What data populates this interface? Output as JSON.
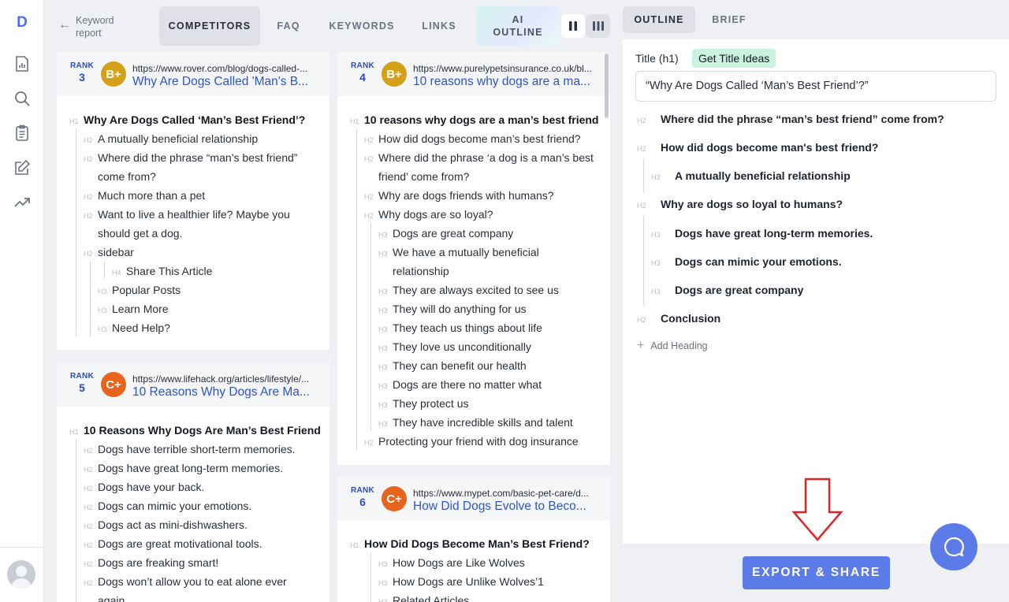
{
  "nav": {
    "logo": "D",
    "icons": [
      "chart-icon",
      "search-icon",
      "clipboard-icon",
      "edit-icon",
      "trending-icon"
    ]
  },
  "topbar": {
    "back_label": "Keyword report",
    "tabs": [
      {
        "label": "COMPETITORS",
        "active": true
      },
      {
        "label": "FAQ",
        "active": false
      },
      {
        "label": "KEYWORDS",
        "active": false
      },
      {
        "label": "LINKS",
        "active": false
      }
    ],
    "ai_tab": {
      "line1": "AI",
      "line2": "OUTLINE"
    }
  },
  "competitors": [
    {
      "rank_label": "RANK",
      "rank": "3",
      "grade": "B+",
      "url": "https://www.rover.com/blog/dogs-called-...",
      "title": "Why Are Dogs Called 'Man's B...",
      "headings": [
        {
          "tag": "H1",
          "text": "Why Are Dogs Called ‘Man’s Best Friend’?"
        },
        {
          "tag": "H2",
          "text": "A mutually beneficial relationship"
        },
        {
          "tag": "H2",
          "text": "Where did the phrase “man’s best friend”"
        },
        {
          "tag": "",
          "text": "come from?"
        },
        {
          "tag": "H2",
          "text": "Much more than a pet"
        },
        {
          "tag": "H2",
          "text": "Want to live a healthier life? Maybe you"
        },
        {
          "tag": "",
          "text": "should get a dog."
        },
        {
          "tag": "H2",
          "text": "sidebar"
        },
        {
          "tag": "H4",
          "text": "Share This Article"
        },
        {
          "tag": "H3",
          "text": "Popular Posts"
        },
        {
          "tag": "H3",
          "text": "Learn More"
        },
        {
          "tag": "H3",
          "text": "Need Help?"
        }
      ]
    },
    {
      "rank_label": "RANK",
      "rank": "5",
      "grade": "C+",
      "url": "https://www.lifehack.org/articles/lifestyle/...",
      "title": "10 Reasons Why Dogs Are Ma...",
      "headings": [
        {
          "tag": "H1",
          "text": "10 Reasons Why Dogs Are Man’s Best Friend"
        },
        {
          "tag": "H2",
          "text": "Dogs have terrible short-term memories."
        },
        {
          "tag": "H2",
          "text": "Dogs have great long-term memories."
        },
        {
          "tag": "H2",
          "text": "Dogs have your back."
        },
        {
          "tag": "H2",
          "text": "Dogs can mimic your emotions."
        },
        {
          "tag": "H2",
          "text": "Dogs act as mini-dishwashers."
        },
        {
          "tag": "H2",
          "text": "Dogs are great motivational tools."
        },
        {
          "tag": "H2",
          "text": "Dogs are freaking smart!"
        },
        {
          "tag": "H2",
          "text": "Dogs won’t allow you to eat alone ever"
        },
        {
          "tag": "",
          "text": "again"
        }
      ]
    },
    {
      "rank_label": "RANK",
      "rank": "4",
      "grade": "B+",
      "url": "https://www.purelypetsinsurance.co.uk/bl...",
      "title": "10 reasons why dogs are a ma...",
      "headings": [
        {
          "tag": "H1",
          "text": "10 reasons why dogs are a man’s best friend"
        },
        {
          "tag": "H2",
          "text": "How did dogs become man’s best friend?"
        },
        {
          "tag": "H2",
          "text": "Where did the phrase ‘a dog is a man’s best"
        },
        {
          "tag": "",
          "text": "friend’ come from?"
        },
        {
          "tag": "H2",
          "text": "Why are dogs friends with humans?"
        },
        {
          "tag": "H2",
          "text": "Why dogs are so loyal?"
        },
        {
          "tag": "H3",
          "text": "Dogs are great company"
        },
        {
          "tag": "H3",
          "text": "We have a mutually beneficial"
        },
        {
          "tag": "",
          "text": "relationship"
        },
        {
          "tag": "H3",
          "text": "They are always excited to see us"
        },
        {
          "tag": "H3",
          "text": "They will do anything for us"
        },
        {
          "tag": "H3",
          "text": "They teach us things about life"
        },
        {
          "tag": "H3",
          "text": "They love us unconditionally"
        },
        {
          "tag": "H3",
          "text": "They can benefit our health"
        },
        {
          "tag": "H3",
          "text": "Dogs are there no matter what"
        },
        {
          "tag": "H3",
          "text": "They protect us"
        },
        {
          "tag": "H3",
          "text": "They have incredible skills and talent"
        },
        {
          "tag": "H2",
          "text": "Protecting your friend with dog insurance"
        }
      ]
    },
    {
      "rank_label": "RANK",
      "rank": "6",
      "grade": "C+",
      "url": "https://www.mypet.com/basic-pet-care/d...",
      "title": "How Did Dogs Evolve to Beco...",
      "headings": [
        {
          "tag": "H1",
          "text": "How Did Dogs Become Man’s Best Friend?"
        },
        {
          "tag": "H3",
          "text": "How Dogs are Like Wolves"
        },
        {
          "tag": "H3",
          "text": "How Dogs are Unlike Wolves’1"
        },
        {
          "tag": "H3",
          "text": "Related Articles"
        }
      ]
    }
  ],
  "outline": {
    "tabs": [
      {
        "label": "OUTLINE",
        "active": true
      },
      {
        "label": "BRIEF",
        "active": false
      }
    ],
    "title_label": "Title (h1)",
    "title_ideas_label": "Get Title Ideas",
    "title_value": "“Why Are Dogs Called ‘Man’s Best Friend’?”",
    "items": [
      {
        "tag": "H2",
        "text": "Where did the phrase “man’s best friend” come from?"
      },
      {
        "tag": "H2",
        "text": "How did dogs become man's best friend?"
      },
      {
        "tag": "H3",
        "text": "A mutually beneficial relationship"
      },
      {
        "tag": "H2",
        "text": "Why are dogs so loyal to humans?"
      },
      {
        "tag": "H3",
        "text": "Dogs have great long-term memories."
      },
      {
        "tag": "H3",
        "text": "Dogs can mimic your emotions."
      },
      {
        "tag": "H3",
        "text": "Dogs are great company"
      },
      {
        "tag": "H2",
        "text": "Conclusion"
      }
    ],
    "add_heading_label": "Add Heading"
  },
  "export_label": "EXPORT & SHARE",
  "colors": {
    "accent": "#5b7be9",
    "rank_blue": "#2b4acb",
    "grade_b": "#d4a017",
    "grade_c": "#e8641c",
    "link": "#2b54d6",
    "highlight": "#c9f3de",
    "annotation_arrow": "#e02424"
  }
}
